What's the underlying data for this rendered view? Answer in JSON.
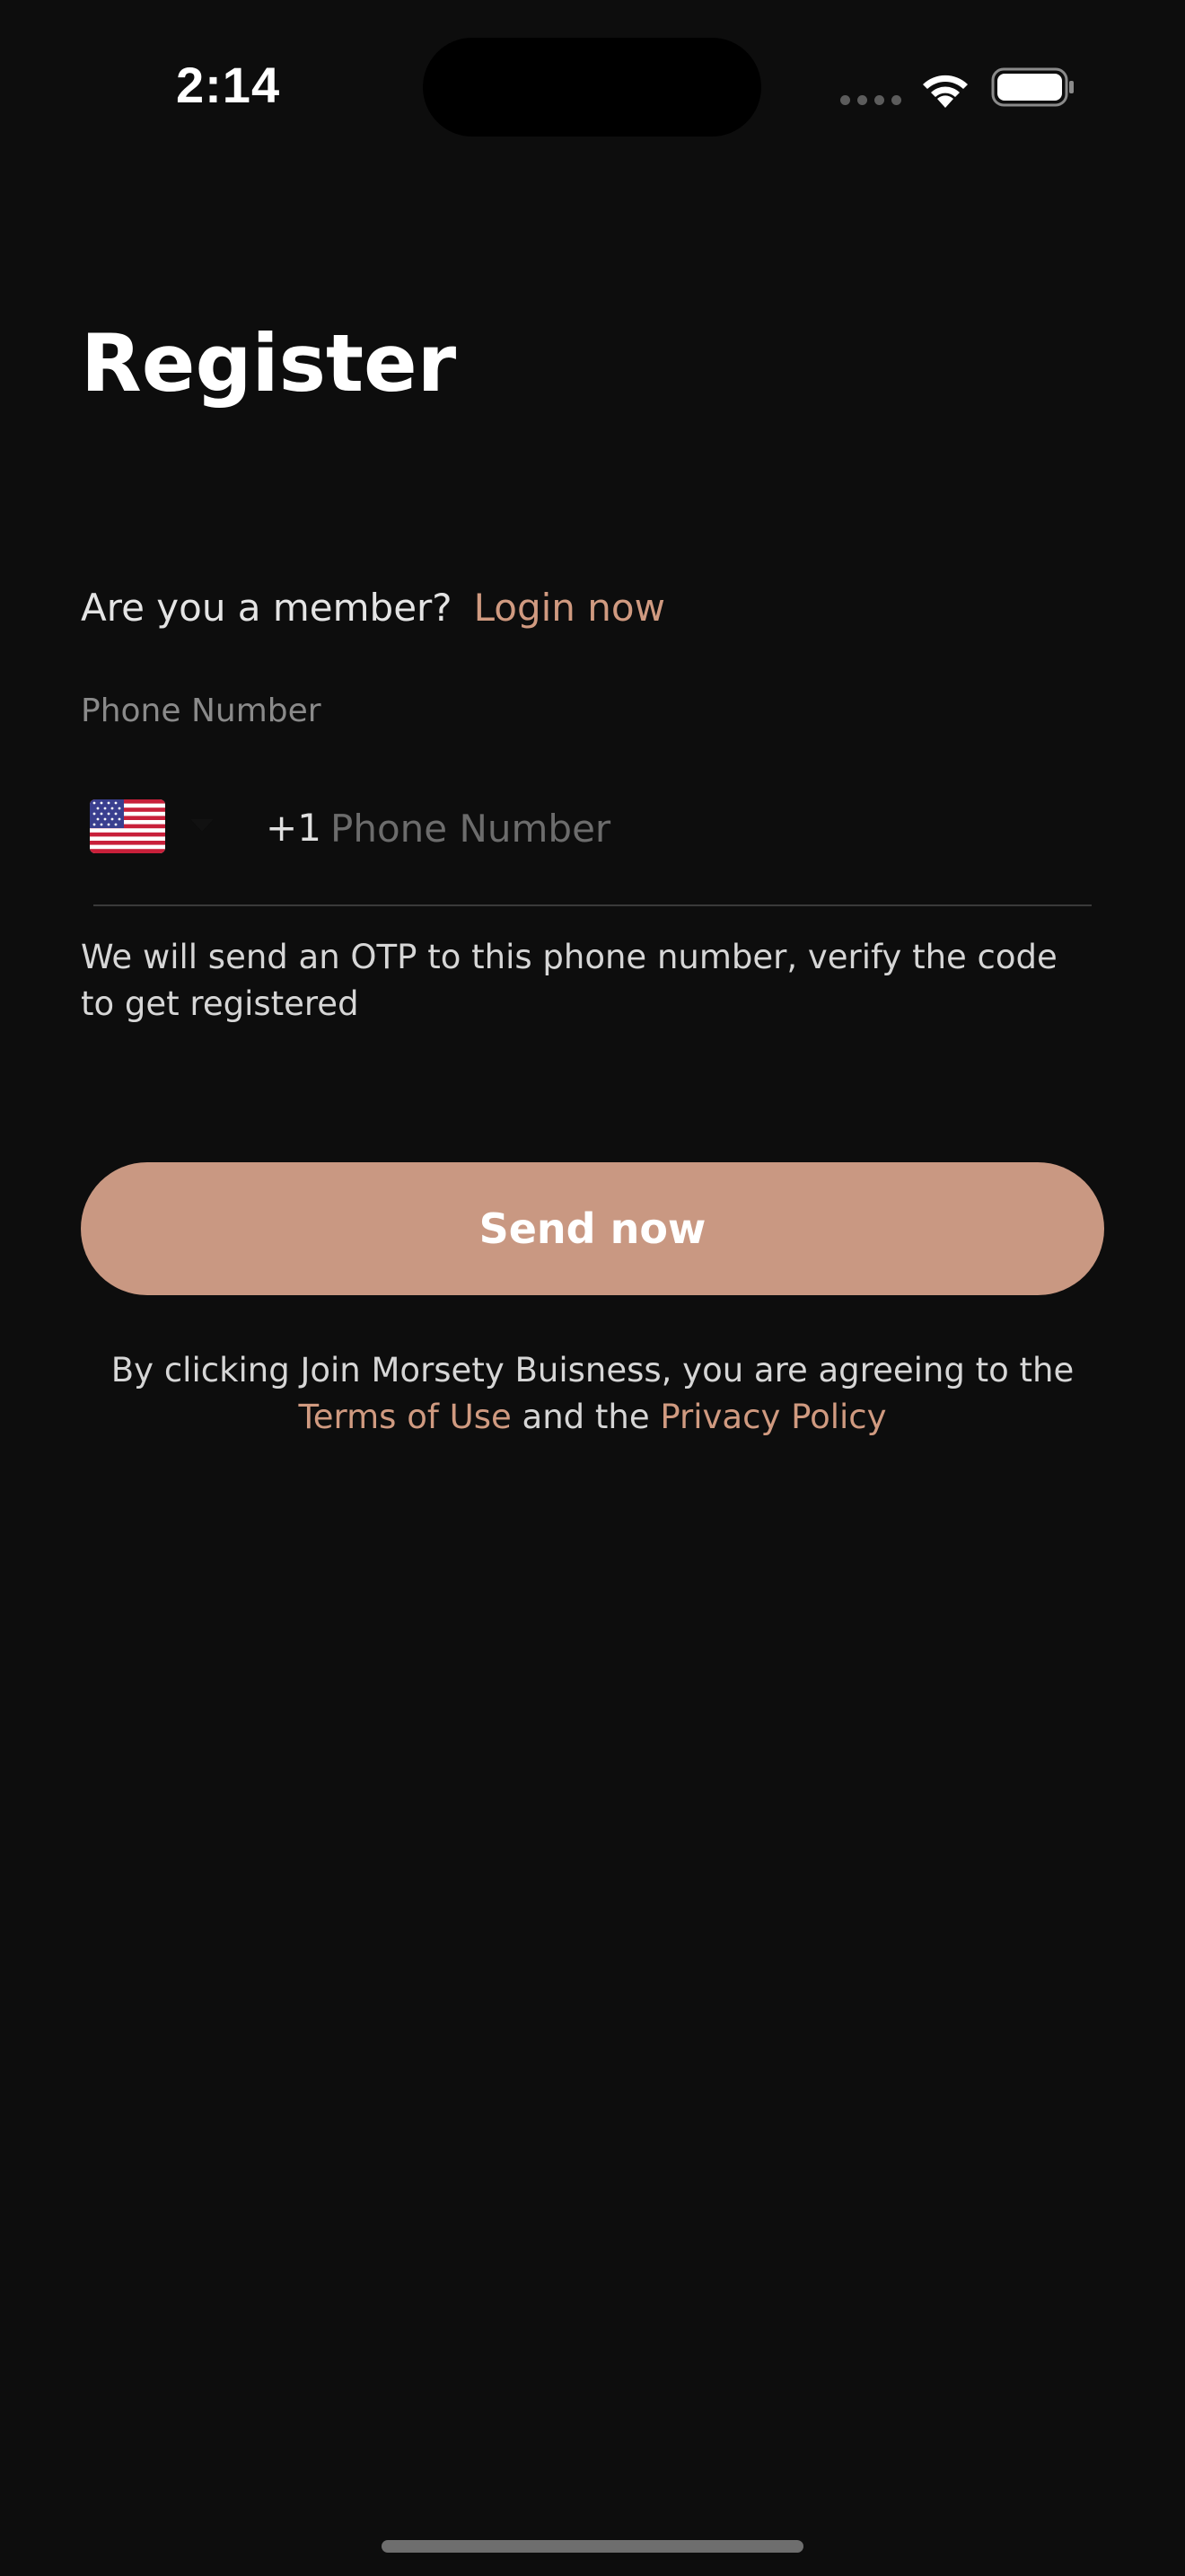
{
  "status_bar": {
    "time": "2:14"
  },
  "header": {
    "title": "Register"
  },
  "member_prompt": {
    "question": "Are you a member?",
    "login_link": "Login now"
  },
  "phone_field": {
    "label": "Phone Number",
    "country_flag": "us-flag-icon",
    "dial_code": "+1",
    "value": "",
    "placeholder": "Phone Number"
  },
  "helper_text": "We will send an OTP to this phone number, verify the code to get registered",
  "send_button": {
    "label": "Send now"
  },
  "terms": {
    "prefix": "By clicking Join Morsety Buisness, you are agreeing to the",
    "terms_link": "Terms of Use",
    "middle": "and the",
    "privacy_link": "Privacy Policy"
  },
  "colors": {
    "background": "#0d0d0d",
    "accent": "#d09a80",
    "button": "#c99882"
  }
}
